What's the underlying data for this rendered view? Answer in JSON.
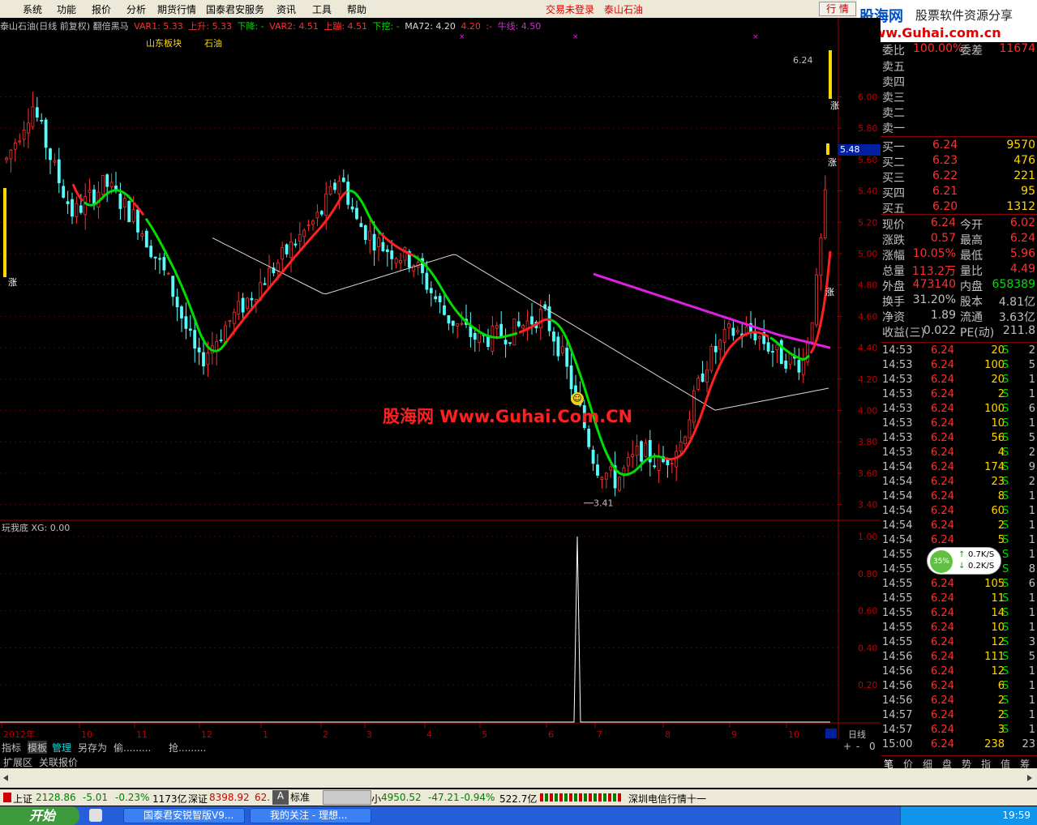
{
  "menu": {
    "items": [
      "系统",
      "功能",
      "报价",
      "分析",
      "期货行情",
      "国泰君安服务",
      "资讯",
      "工具",
      "帮助"
    ],
    "trade_status": "交易未登录",
    "stock_name": "泰山石油",
    "quote_button": "行 情"
  },
  "logo": {
    "line1": "股海网",
    "line1b": "股票软件资源分享",
    "line2": "Www.Guhai.com.cn"
  },
  "info_row": {
    "title": "泰山石油(日线 前复权) 翻倍黑马",
    "var1": "VAR1: 5.33",
    "up": "上升: 5.33",
    "down": "下降: -",
    "var2": "VAR2: 4.51",
    "jump": "上蹦: 4.51",
    "pick": "下挖: -",
    "ma72": "MA72: 4.20",
    "val420": "4.20",
    "colon": ":-",
    "bull": "牛线: 4.50"
  },
  "sector": {
    "label": "山东板块",
    "value": "石油"
  },
  "watermark": "股海网 Www.Guhai.Com.CN",
  "chart_data": [
    {
      "type": "line",
      "title": "泰山石油(日线 前复权) 翻倍黑马",
      "ylim": [
        3.3,
        6.4
      ],
      "y_ticks": [
        "6.00",
        "5.80",
        "5.60",
        "5.40",
        "5.20",
        "5.00",
        "4.80",
        "4.60",
        "4.40",
        "4.20",
        "4.00",
        "3.80",
        "3.60",
        "3.40"
      ],
      "current_price_tag": "5.48",
      "max_label": "6.24",
      "min_label": "3.41",
      "x_ticks": [
        "2012年",
        "10",
        "11",
        "12",
        "1",
        "2",
        "3",
        "4",
        "5",
        "6",
        "7",
        "8",
        "9",
        "10"
      ],
      "x_right_label": "日线",
      "series": [
        {
          "name": "上升",
          "color": "#00dd00"
        },
        {
          "name": "上蹦",
          "color": "#dd0000"
        },
        {
          "name": "MA72",
          "color": "#d8d8d8"
        },
        {
          "name": "牛线",
          "color": "#e020e0"
        }
      ],
      "markers": [
        "涨",
        "涨",
        "涨",
        "涨"
      ]
    },
    {
      "type": "line",
      "title": "玩我底",
      "label": "玩我底 XG: 0.00",
      "ylim": [
        0,
        1.0
      ],
      "y_ticks": [
        "1.00",
        "0.80",
        "0.60",
        "0.40",
        "0.20"
      ]
    }
  ],
  "orderbook": {
    "header": {
      "l1": "委比",
      "v1": "100.00%",
      "l2": "委差",
      "v2": "11674"
    },
    "sell": [
      "卖五",
      "卖四",
      "卖三",
      "卖二",
      "卖一"
    ],
    "buy": [
      {
        "label": "买一",
        "price": "6.24",
        "vol": "9570"
      },
      {
        "label": "买二",
        "price": "6.23",
        "vol": "476"
      },
      {
        "label": "买三",
        "price": "6.22",
        "vol": "221"
      },
      {
        "label": "买四",
        "price": "6.21",
        "vol": "95"
      },
      {
        "label": "买五",
        "price": "6.20",
        "vol": "1312"
      }
    ],
    "stats": [
      {
        "l1": "现价",
        "v1": "6.24",
        "l2": "今开",
        "v2": "6.02"
      },
      {
        "l1": "涨跌",
        "v1": "0.57",
        "l2": "最高",
        "v2": "6.24"
      },
      {
        "l1": "涨幅",
        "v1": "10.05%",
        "l2": "最低",
        "v2": "5.96"
      },
      {
        "l1": "总量",
        "v1": "113.2万",
        "l2": "量比",
        "v2": "4.49"
      },
      {
        "l1": "外盘",
        "v1": "473140",
        "l2": "内盘",
        "v2": "658389"
      },
      {
        "l1": "换手",
        "v1": "31.20%",
        "l2": "股本",
        "v2": "4.81亿"
      },
      {
        "l1": "净资",
        "v1": "1.89",
        "l2": "流通",
        "v2": "3.63亿"
      },
      {
        "l1": "收益(三)",
        "v1": "0.022",
        "l2": "PE(动)",
        "v2": "211.8"
      }
    ]
  },
  "ticks": [
    [
      "14:53",
      "6.24",
      "20",
      "S",
      "2"
    ],
    [
      "14:53",
      "6.24",
      "100",
      "S",
      "5"
    ],
    [
      "14:53",
      "6.24",
      "20",
      "S",
      "1"
    ],
    [
      "14:53",
      "6.24",
      "2",
      "S",
      "1"
    ],
    [
      "14:53",
      "6.24",
      "100",
      "S",
      "6"
    ],
    [
      "14:53",
      "6.24",
      "10",
      "S",
      "1"
    ],
    [
      "14:53",
      "6.24",
      "56",
      "S",
      "5"
    ],
    [
      "14:53",
      "6.24",
      "4",
      "S",
      "2"
    ],
    [
      "14:54",
      "6.24",
      "174",
      "S",
      "9"
    ],
    [
      "14:54",
      "6.24",
      "23",
      "S",
      "2"
    ],
    [
      "14:54",
      "6.24",
      "8",
      "S",
      "1"
    ],
    [
      "14:54",
      "6.24",
      "60",
      "S",
      "1"
    ],
    [
      "14:54",
      "6.24",
      "2",
      "S",
      "1"
    ],
    [
      "14:54",
      "6.24",
      "5",
      "S",
      "1"
    ],
    [
      "14:55",
      "6.24",
      "",
      "S",
      "1"
    ],
    [
      "14:55",
      "6.24",
      "",
      "S",
      "8"
    ],
    [
      "14:55",
      "6.24",
      "105",
      "S",
      "6"
    ],
    [
      "14:55",
      "6.24",
      "11",
      "S",
      "1"
    ],
    [
      "14:55",
      "6.24",
      "14",
      "S",
      "1"
    ],
    [
      "14:55",
      "6.24",
      "10",
      "S",
      "1"
    ],
    [
      "14:55",
      "6.24",
      "12",
      "S",
      "3"
    ],
    [
      "14:56",
      "6.24",
      "111",
      "S",
      "5"
    ],
    [
      "14:56",
      "6.24",
      "12",
      "S",
      "1"
    ],
    [
      "14:56",
      "6.24",
      "6",
      "S",
      "1"
    ],
    [
      "14:56",
      "6.24",
      "2",
      "S",
      "1"
    ],
    [
      "14:57",
      "6.24",
      "2",
      "S",
      "1"
    ],
    [
      "14:57",
      "6.24",
      "3",
      "S",
      "1"
    ],
    [
      "15:00",
      "6.24",
      "238",
      "",
      "23"
    ]
  ],
  "net_widget": {
    "pct": "35%",
    "up": "0.7K/S",
    "down": "0.2K/S"
  },
  "bottom_tabs": [
    "笔",
    "价",
    "细",
    "盘",
    "势",
    "指",
    "值",
    "筹"
  ],
  "tabs_row1": [
    "指标",
    "模板",
    "管理",
    "另存为",
    "偷.........",
    "抢........."
  ],
  "tabs_row2": [
    "扩展区",
    "关联报价"
  ],
  "status": {
    "sh_label": "上证",
    "sh_val": "2128.86",
    "sh_chg": "-5.01",
    "sh_pct": "-0.23%",
    "sh_amt": "1173亿",
    "sz_label": "深证",
    "sz_val": "8398.92",
    "sz_more": "62.",
    "std": "标准",
    "small_label": "小",
    "small_val": "4950.52",
    "small_chg": "-47.21",
    "small_pct": "-0.94%",
    "small_amt": "522.7亿",
    "news": "深圳电信行情十一"
  },
  "taskbar": {
    "start": "开始",
    "tasks": [
      "国泰君安锐智版V9...",
      "我的关注 - 理想..."
    ],
    "clock": "19:59"
  }
}
